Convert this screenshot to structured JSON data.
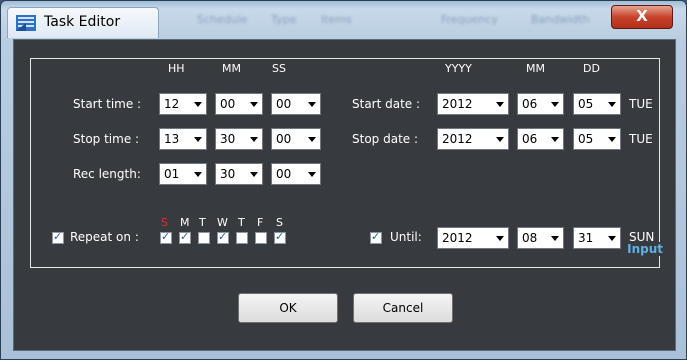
{
  "window": {
    "title": "Task Editor",
    "close_glyph": "X",
    "background_menu": [
      "Schedule",
      "Type",
      "Items",
      "Frequency",
      "Bandwidth"
    ]
  },
  "headers": {
    "hh": "HH",
    "mm": "MM",
    "ss": "SS",
    "yyyy": "YYYY",
    "mm2": "MM",
    "dd": "DD"
  },
  "start_time": {
    "label": "Start time :",
    "hh": "12",
    "mm": "00",
    "ss": "00"
  },
  "stop_time": {
    "label": "Stop time  :",
    "hh": "13",
    "mm": "30",
    "ss": "00"
  },
  "rec_length": {
    "label": "Rec length:",
    "hh": "01",
    "mm": "30",
    "ss": "00"
  },
  "start_date": {
    "label": "Start date :",
    "yyyy": "2012",
    "mm": "06",
    "dd": "05",
    "weekday": "TUE"
  },
  "stop_date": {
    "label": "Stop date :",
    "yyyy": "2012",
    "mm": "06",
    "dd": "05",
    "weekday": "TUE"
  },
  "repeat": {
    "label": "Repeat on :",
    "checked": true,
    "days": [
      {
        "letter": "S",
        "checked": true,
        "color": "#e03030"
      },
      {
        "letter": "M",
        "checked": true,
        "color": "#ffffff"
      },
      {
        "letter": "T",
        "checked": false,
        "color": "#ffffff"
      },
      {
        "letter": "W",
        "checked": true,
        "color": "#ffffff"
      },
      {
        "letter": "T",
        "checked": false,
        "color": "#ffffff"
      },
      {
        "letter": "F",
        "checked": false,
        "color": "#ffffff"
      },
      {
        "letter": "S",
        "checked": true,
        "color": "#ffffff"
      }
    ]
  },
  "until": {
    "label": "Until:",
    "checked": true,
    "yyyy": "2012",
    "mm": "08",
    "dd": "31",
    "weekday": "SUN"
  },
  "group_label": "Input",
  "buttons": {
    "ok": "OK",
    "cancel": "Cancel"
  },
  "colors": {
    "client_bg": "#373b40",
    "accent": "#5eb0e8",
    "close": "#c8442c"
  }
}
